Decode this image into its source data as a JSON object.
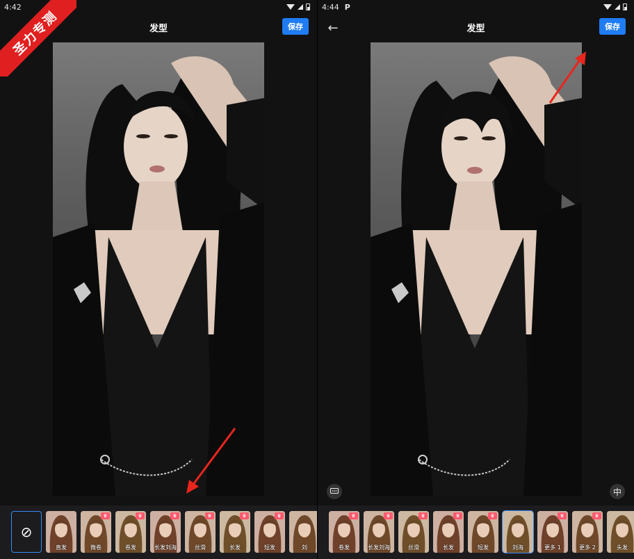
{
  "left": {
    "status": {
      "time": "4:42"
    },
    "top_bar": {
      "title": "发型",
      "save_label": "保存"
    },
    "feedback_icon": "message-icon",
    "tiles": [
      {
        "label": "直发",
        "vip": false
      },
      {
        "label": "微卷",
        "vip": true
      },
      {
        "label": "卷发",
        "vip": true
      },
      {
        "label": "长发刘海",
        "vip": true
      },
      {
        "label": "丝滑",
        "vip": true
      },
      {
        "label": "长发",
        "vip": true
      },
      {
        "label": "短发",
        "vip": true
      },
      {
        "label": "刘",
        "vip": false
      }
    ]
  },
  "right": {
    "status": {
      "time": "4:44",
      "extra": "P"
    },
    "top_bar": {
      "title": "发型",
      "save_label": "保存"
    },
    "lang_label": "中",
    "tiles": [
      {
        "label": "卷发",
        "vip": true
      },
      {
        "label": "长发刘海",
        "vip": true
      },
      {
        "label": "丝滑",
        "vip": true
      },
      {
        "label": "长发",
        "vip": true
      },
      {
        "label": "短发",
        "vip": true
      },
      {
        "label": "刘海",
        "vip": false,
        "selected": true
      },
      {
        "label": "更多 1",
        "vip": true
      },
      {
        "label": "更多 2",
        "vip": true
      },
      {
        "label": "头发",
        "vip": false
      }
    ]
  },
  "watermark": {
    "text": "圣力专测"
  },
  "colors": {
    "accent": "#1f7cf2",
    "vip": "#ff5a6e",
    "arrow": "#e8261d",
    "watermark": "#e02020"
  }
}
